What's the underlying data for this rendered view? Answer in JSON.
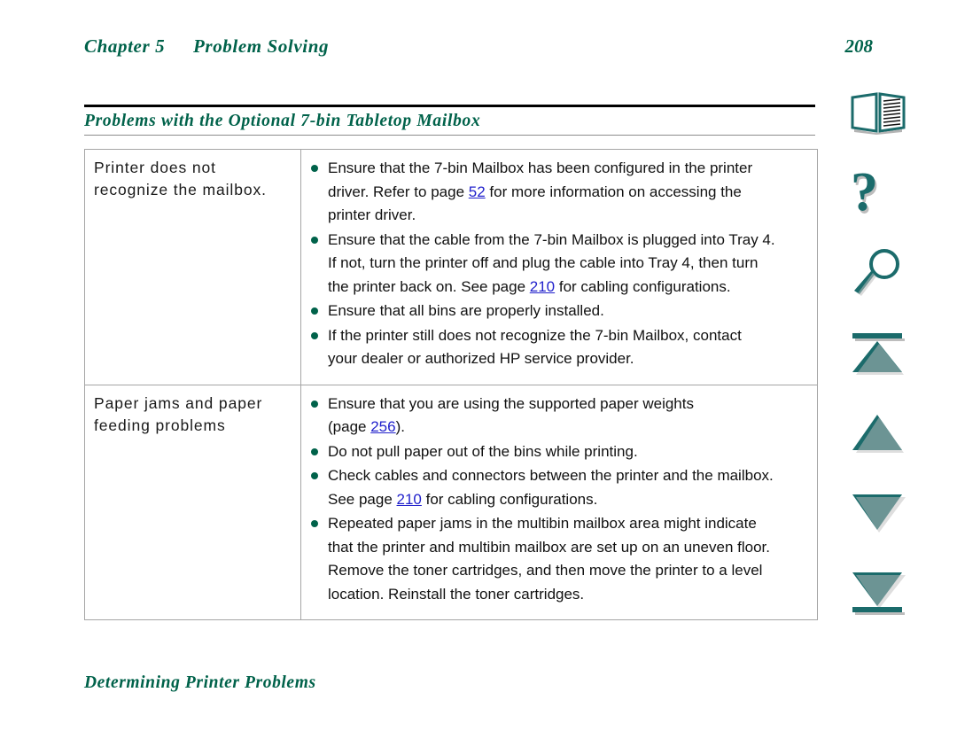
{
  "running_head": {
    "chapter": "Chapter 5",
    "title": "Problem Solving",
    "page_number": "208"
  },
  "section": {
    "heading": "Problems with the Optional 7-bin Tabletop Mailbox"
  },
  "table": {
    "rows": [
      {
        "label": "Printer does not recognize the mailbox.",
        "bullets": [
          {
            "lines": [
              [
                {
                  "t": "Ensure that the 7-bin Mailbox has been configured in the printer"
                }
              ],
              [
                {
                  "t": "driver. Refer to page "
                },
                {
                  "t": "52",
                  "link": true
                },
                {
                  "t": " for more information on accessing the"
                }
              ],
              [
                {
                  "t": "printer driver."
                }
              ]
            ]
          },
          {
            "lines": [
              [
                {
                  "t": "Ensure that the cable from the 7-bin Mailbox is plugged into Tray 4."
                }
              ],
              [
                {
                  "t": "If not, turn the printer off and plug the cable into Tray 4, then turn"
                }
              ],
              [
                {
                  "t": "the printer back on. See page "
                },
                {
                  "t": "210",
                  "link": true
                },
                {
                  "t": " for cabling configurations."
                }
              ]
            ]
          },
          {
            "lines": [
              [
                {
                  "t": "Ensure that all bins are properly installed."
                }
              ]
            ]
          },
          {
            "lines": [
              [
                {
                  "t": "If the printer still does not recognize the 7-bin Mailbox, contact"
                }
              ],
              [
                {
                  "t": "your dealer or authorized HP service provider."
                }
              ]
            ]
          }
        ]
      },
      {
        "label": "Paper jams and paper feeding problems",
        "bullets": [
          {
            "lines": [
              [
                {
                  "t": "Ensure that you are using the supported paper weights"
                }
              ],
              [
                {
                  "t": "(page "
                },
                {
                  "t": "256",
                  "link": true
                },
                {
                  "t": ")."
                }
              ]
            ]
          },
          {
            "lines": [
              [
                {
                  "t": "Do not pull paper out of the bins while printing."
                }
              ]
            ]
          },
          {
            "lines": [
              [
                {
                  "t": "Check cables and connectors between the printer and the mailbox."
                }
              ],
              [
                {
                  "t": "See page "
                },
                {
                  "t": "210",
                  "link": true
                },
                {
                  "t": " for cabling configurations."
                }
              ]
            ]
          },
          {
            "lines": [
              [
                {
                  "t": "Repeated paper jams in the multibin mailbox area might indicate"
                }
              ],
              [
                {
                  "t": "that the printer and multibin mailbox are set up on an uneven floor."
                }
              ],
              [
                {
                  "t": "Remove the toner cartridges, and then move the printer to a level"
                }
              ],
              [
                {
                  "t": "location. Reinstall the toner cartridges."
                }
              ]
            ]
          }
        ]
      }
    ]
  },
  "nav_rail": {
    "buttons": [
      {
        "icon": "book-icon",
        "name": "contents-button"
      },
      {
        "icon": "question-mark-icon",
        "name": "help-button"
      },
      {
        "icon": "magnifying-glass-icon",
        "name": "search-button"
      },
      {
        "icon": "first-page-icon",
        "name": "first-page-button"
      },
      {
        "icon": "previous-page-icon",
        "name": "previous-page-button"
      },
      {
        "icon": "next-page-icon",
        "name": "next-page-button"
      },
      {
        "icon": "last-page-icon",
        "name": "last-page-button"
      }
    ]
  },
  "footer": {
    "text": "Determining Printer Problems"
  },
  "colors": {
    "accent_green": "#00624a",
    "icon_teal": "#1b6b6b",
    "link_blue": "#2222cc"
  }
}
